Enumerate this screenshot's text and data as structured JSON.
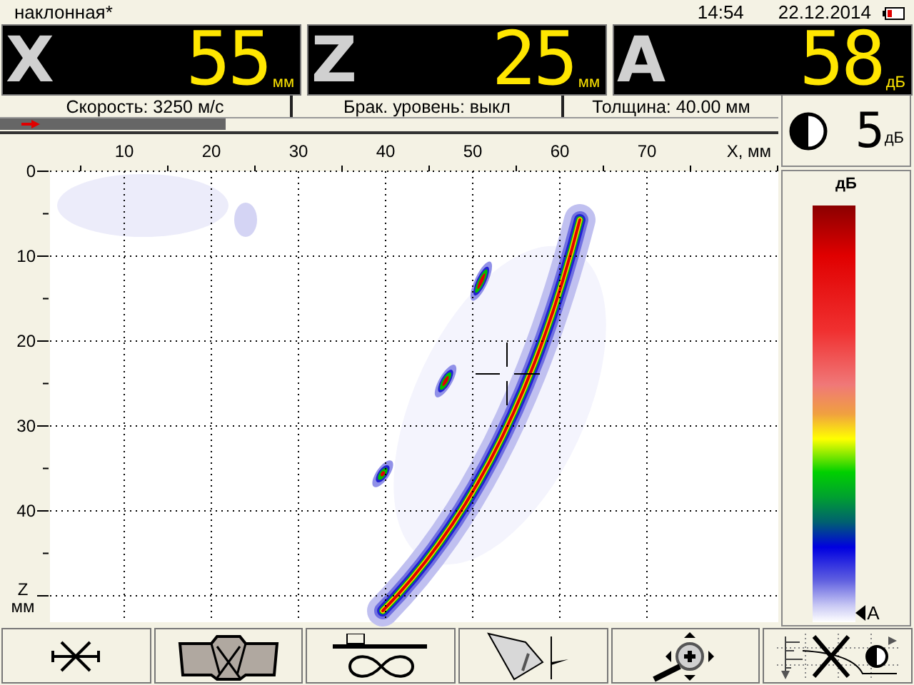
{
  "header": {
    "title": "наклонная*",
    "time": "14:54",
    "date": "22.12.2014"
  },
  "readouts": [
    {
      "axis": "X",
      "value": "55",
      "unit": "мм"
    },
    {
      "axis": "Z",
      "value": "25",
      "unit": "мм"
    },
    {
      "axis": "A",
      "value": "58",
      "unit": "дБ"
    }
  ],
  "info": [
    "Скорость: 3250 м/с",
    "Брак. уровень: выкл",
    "Толщина: 40.00 мм"
  ],
  "progress": {
    "level": 0.29
  },
  "gain": {
    "value": "5",
    "unit": "дБ"
  },
  "colorbar": {
    "title": "дБ",
    "marker": "A"
  },
  "scan": {
    "x_ticks": [
      "10",
      "20",
      "30",
      "40",
      "50",
      "60",
      "70"
    ],
    "x_label": "X, мм",
    "z_ticks": [
      "0",
      "10",
      "20",
      "30",
      "40"
    ],
    "z_label": [
      "Z",
      "мм"
    ]
  },
  "toolbar": [
    {
      "kind": "cursor"
    },
    {
      "kind": "weld"
    },
    {
      "kind": "scan"
    },
    {
      "kind": "beam"
    },
    {
      "kind": "zoom"
    },
    {
      "kind": "curve"
    }
  ]
}
